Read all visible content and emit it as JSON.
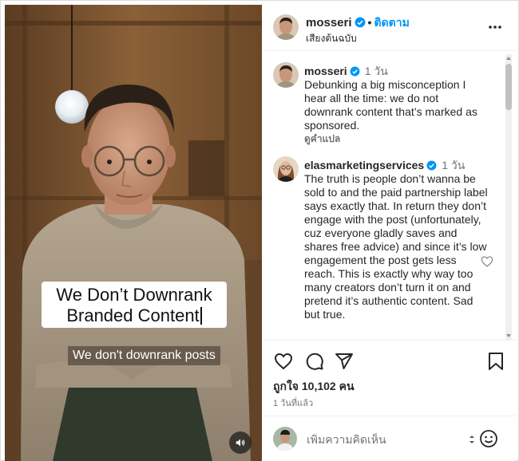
{
  "video": {
    "caption_title_line1": "We Don’t Downrank",
    "caption_title_line2": "Branded Content",
    "caption_sub": "We don't downrank posts"
  },
  "header": {
    "username": "mosseri",
    "separator": "•",
    "follow_label": "ติดตาม",
    "audio_label": "เสียงต้นฉบับ"
  },
  "comments": [
    {
      "username": "mosseri",
      "time": "1 วัน",
      "text": "Debunking a big misconception I hear all the time: we do not downrank content that’s marked as sponsored.",
      "translate_label": "ดูคำแปล"
    },
    {
      "username": "elasmarketingservices",
      "time": "1 วัน",
      "text": "The truth is people don’t wanna be sold to and the paid partnership label says exactly that. In return they don’t engage with the post (unfortunately, cuz everyone gladly saves and shares free advice) and since it’s low engagement the post gets less reach. This is exactly why way too many creators don’t turn it on and pretend it’s authentic content. Sad but true."
    }
  ],
  "actions": {
    "likes": "ถูกใจ 10,102 คน",
    "time_ago": "1 วันที่แล้ว"
  },
  "comment_bar": {
    "placeholder": "เพิ่มความคิดเห็น"
  },
  "colors": {
    "accent": "#0095f6",
    "text": "#262626",
    "muted": "#737373"
  },
  "icons": [
    "verified-icon",
    "more-icon",
    "heart-icon",
    "comment-icon",
    "share-icon",
    "bookmark-icon",
    "emoji-icon",
    "mute-icon"
  ]
}
